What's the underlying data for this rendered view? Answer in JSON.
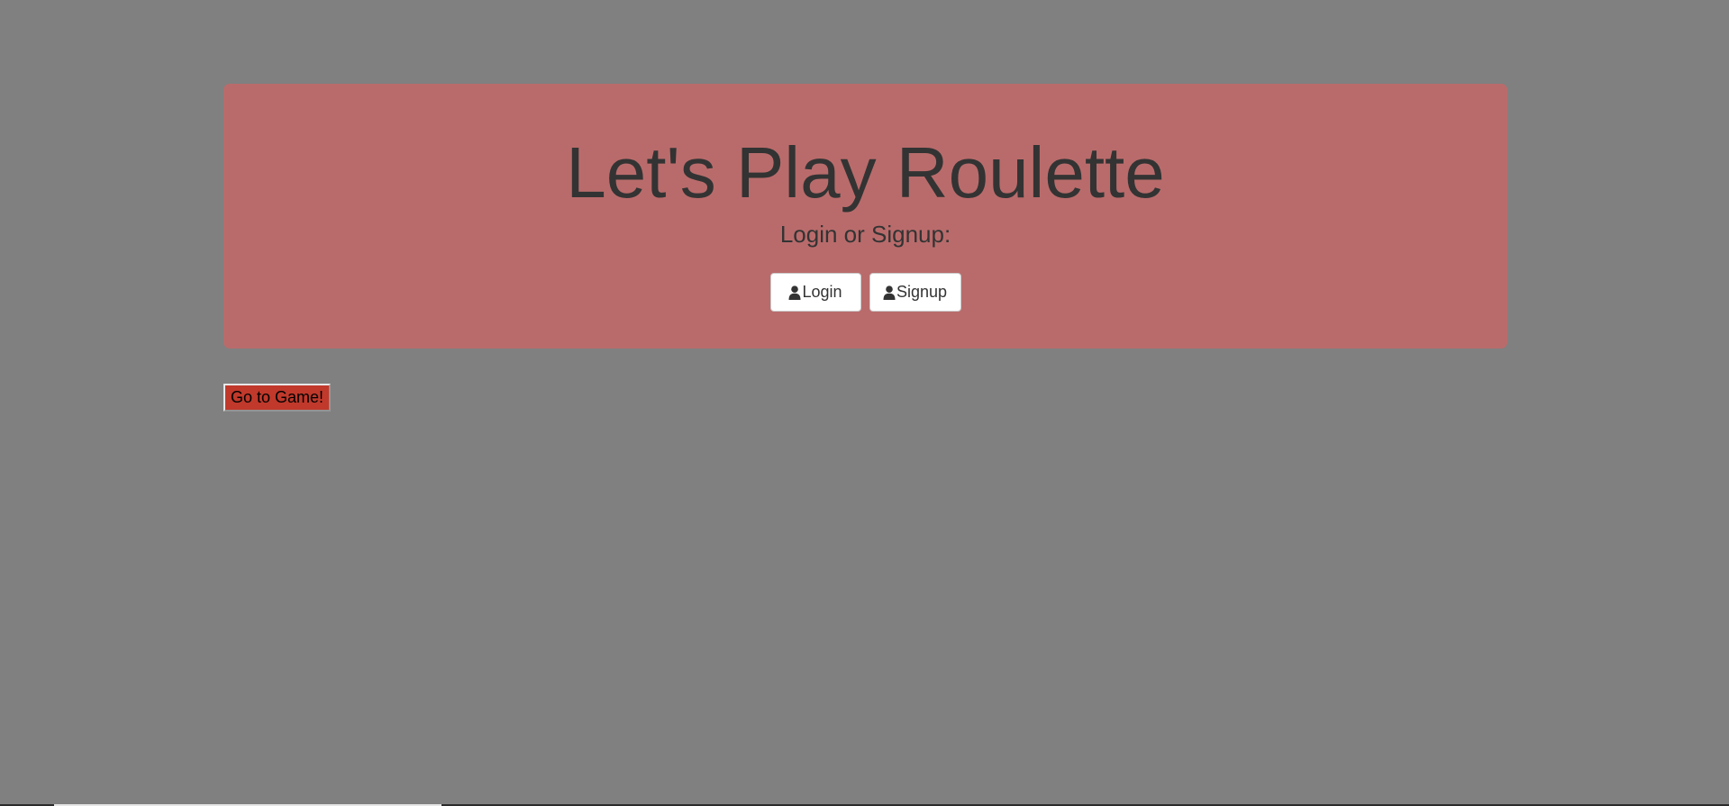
{
  "page": {
    "background_color": "#808080"
  },
  "hero": {
    "title": "Let's Play Roulette",
    "subtitle": "Login or Signup:",
    "background_color": "#b96b6b",
    "buttons": {
      "login": {
        "label": "Login",
        "icon": "user-icon"
      },
      "signup": {
        "label": "Signup",
        "icon": "user-icon"
      }
    }
  },
  "game_button": {
    "label": "Go to Game!",
    "color": "#c0392b"
  }
}
